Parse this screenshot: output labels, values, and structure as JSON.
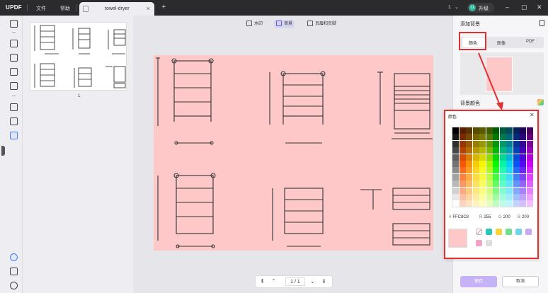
{
  "app": {
    "logo_main": "UPDF",
    "menu": [
      "文件",
      "帮助"
    ]
  },
  "tab": {
    "label": "towel-dryer",
    "close": "×"
  },
  "window": {
    "version": "1",
    "upgrade_label": "升级",
    "avatar_initial": "U"
  },
  "toolbar": {
    "watermark": "水印",
    "background": "背景",
    "header_footer": "页眉和页脚"
  },
  "thumbnails": {
    "page_number": "1"
  },
  "pager": {
    "current": "1",
    "separator": "/",
    "total": "1"
  },
  "right_panel": {
    "title": "添加背景",
    "tabs": [
      "颜色",
      "图像",
      "PDF"
    ],
    "active_tab": "颜色",
    "background_color_label": "背景颜色",
    "apply_label": "保存",
    "cancel_label": "取消"
  },
  "color_popup": {
    "title": "颜色",
    "hex_key": "#",
    "hex_value": "FFC8C8",
    "r_key": "R",
    "r_value": "255",
    "g_key": "G",
    "g_value": "200",
    "b_key": "B",
    "b_value": "200",
    "selected_color": "#FFC8C8",
    "recent_colors": [
      "#2cc6b8",
      "#f6d33c",
      "#6fe08f",
      "#6fd3ee",
      "#c8a8f4",
      "#f3a1c4"
    ]
  },
  "colors": {
    "accent": "#5b5bd6",
    "highlight_box": "#e0302f",
    "page_background": "#ffc8c8"
  }
}
